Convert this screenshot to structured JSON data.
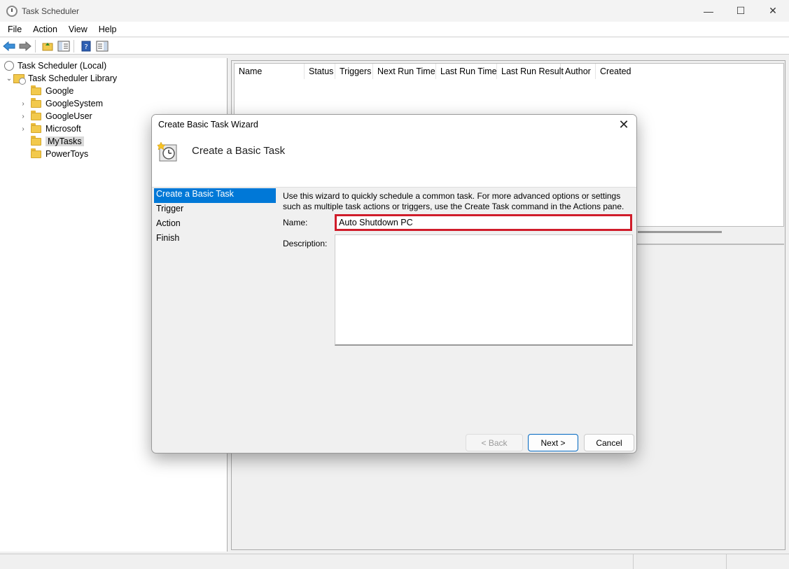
{
  "window": {
    "title": "Task Scheduler",
    "controls": [
      "—",
      "☐",
      "✕"
    ]
  },
  "menu": [
    "File",
    "Action",
    "View",
    "Help"
  ],
  "tree": {
    "root": "Task Scheduler (Local)",
    "library": "Task Scheduler Library",
    "folders": [
      {
        "label": "Google",
        "expandable": false
      },
      {
        "label": "GoogleSystem",
        "expandable": true
      },
      {
        "label": "GoogleUser",
        "expandable": true
      },
      {
        "label": "Microsoft",
        "expandable": true
      },
      {
        "label": "MyTasks",
        "expandable": false,
        "selected": true
      },
      {
        "label": "PowerToys",
        "expandable": false
      }
    ]
  },
  "task_list": {
    "columns": [
      "Name",
      "Status",
      "Triggers",
      "Next Run Time",
      "Last Run Time",
      "Last Run Result",
      "Author",
      "Created"
    ]
  },
  "dialog": {
    "title": "Create Basic Task Wizard",
    "heading": "Create a Basic Task",
    "steps": [
      "Create a Basic Task",
      "Trigger",
      "Action",
      "Finish"
    ],
    "active_step": "Create a Basic Task",
    "intro": "Use this wizard to quickly schedule a common task.  For more advanced options or settings such as multiple task actions or triggers, use the Create Task command in the Actions pane.",
    "name_label": "Name:",
    "name_value": "Auto Shutdown PC",
    "description_label": "Description:",
    "description_value": "",
    "buttons": {
      "back": "< Back",
      "next": "Next >",
      "cancel": "Cancel"
    }
  },
  "colors": {
    "selection": "#0078d7",
    "highlight_border": "#d01c2a"
  }
}
